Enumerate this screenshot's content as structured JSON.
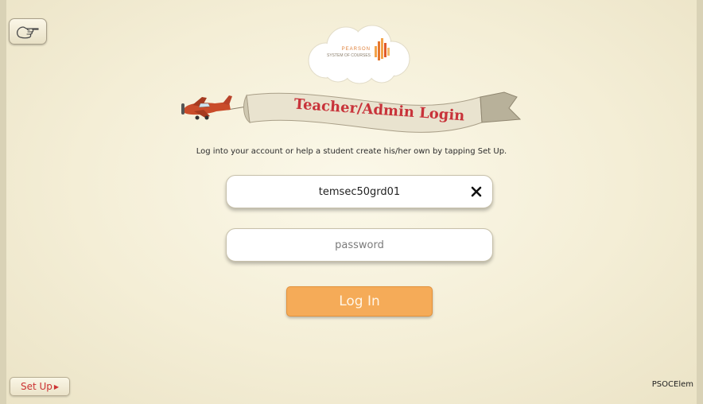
{
  "brand": {
    "line1": "PEARSON",
    "line2": "SYSTEM OF COURSES"
  },
  "banner": {
    "title": "Teacher/Admin Login"
  },
  "instruction": "Log into your account or help a student create his/her own by tapping Set Up.",
  "form": {
    "username_value": "temsec50grd01",
    "password_placeholder": "password",
    "login_label": "Log In"
  },
  "footer": {
    "setup_label": "Set Up",
    "app_name": "PSOCElem"
  },
  "colors": {
    "accent": "#f5ab58",
    "title": "#c8333a",
    "background": "#f4eed6"
  },
  "icons": {
    "back": "pointing-hand-icon",
    "clear": "close-icon",
    "setup_arrow": "triangle-right-icon"
  }
}
